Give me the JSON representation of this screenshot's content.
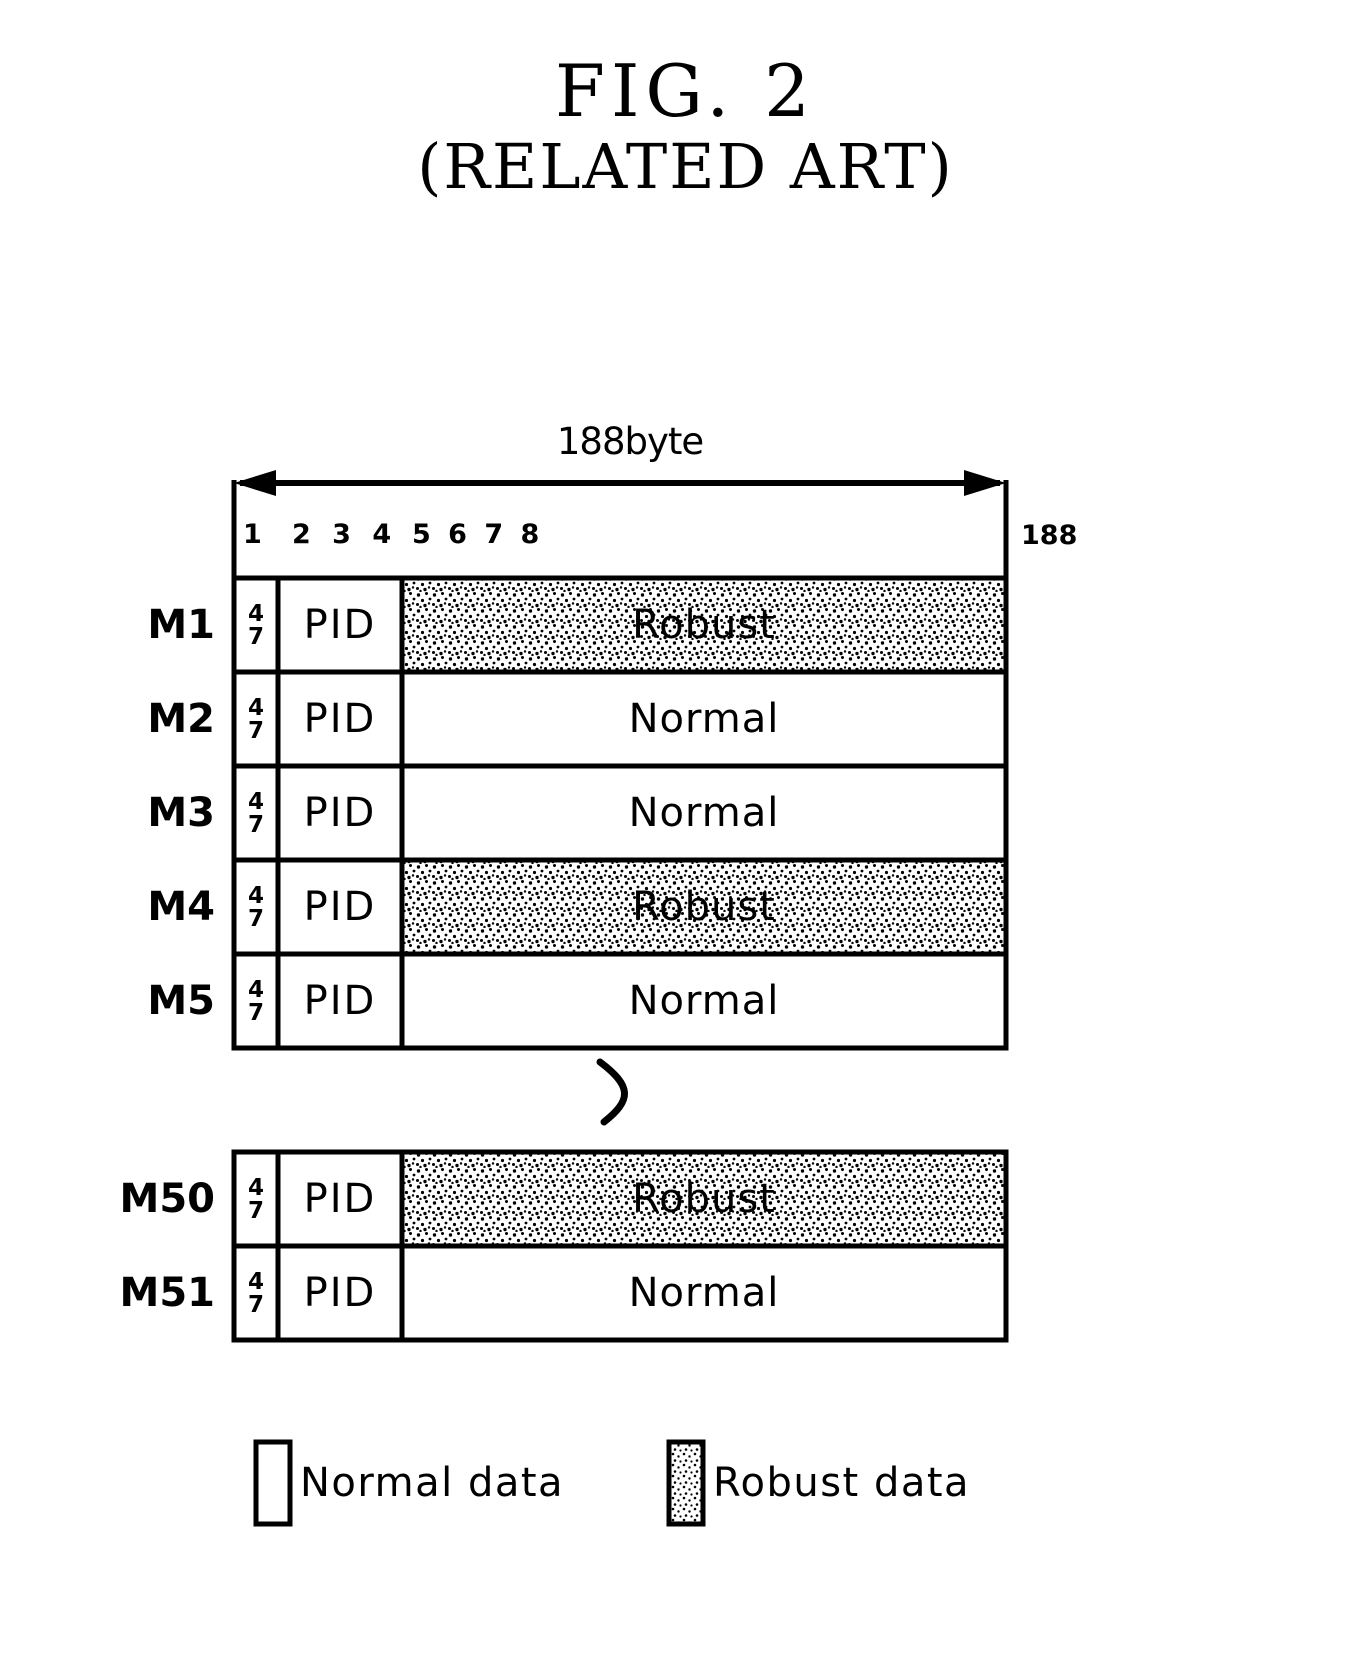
{
  "figure": {
    "title": "FIG. 2",
    "subtitle": "(RELATED ART)"
  },
  "ruler": {
    "width_caption": "188byte",
    "byte_labels": [
      "1",
      "2 3 4",
      "5 6 7 8"
    ],
    "end_label": "188"
  },
  "table": {
    "sync_byte": {
      "top": "4",
      "bottom": "7"
    },
    "pid_label": "PID",
    "rows": [
      {
        "id": "M1",
        "label": "M1",
        "payload": "Robust",
        "type": "robust"
      },
      {
        "id": "M2",
        "label": "M2",
        "payload": "Normal",
        "type": "normal"
      },
      {
        "id": "M3",
        "label": "M3",
        "payload": "Normal",
        "type": "normal"
      },
      {
        "id": "M4",
        "label": "M4",
        "payload": "Robust",
        "type": "robust"
      },
      {
        "id": "M5",
        "label": "M5",
        "payload": "Normal",
        "type": "normal"
      },
      {
        "id": "M50",
        "label": "M50",
        "payload": "Robust",
        "type": "robust"
      },
      {
        "id": "M51",
        "label": "M51",
        "payload": "Normal",
        "type": "normal"
      }
    ]
  },
  "legend": {
    "items": [
      {
        "key": "normal",
        "label": "Normal data",
        "swatch": "white"
      },
      {
        "key": "robust",
        "label": "Robust data",
        "swatch": "stippled"
      }
    ]
  },
  "colors": {
    "ink": "#000000",
    "paper": "#ffffff",
    "stipple": "#000000"
  }
}
